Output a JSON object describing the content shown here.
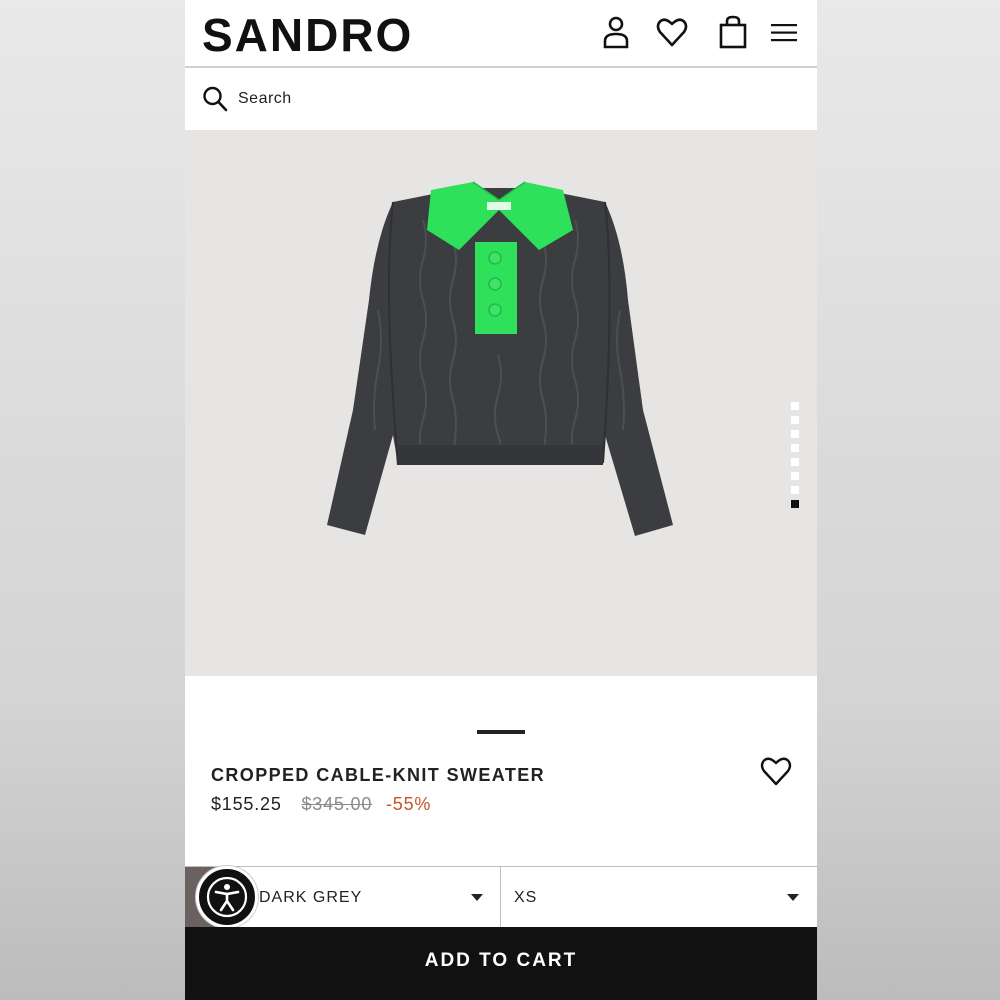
{
  "header": {
    "logo": "SANDRO",
    "icons": [
      "account-icon",
      "wishlist-icon",
      "bag-icon",
      "menu-icon"
    ]
  },
  "search": {
    "placeholder": "Search",
    "icon": "search-icon"
  },
  "gallery": {
    "total_images": 8,
    "active_index": 8,
    "image_alt": "Dark grey cable-knit sweater with bright green collar"
  },
  "product": {
    "name": "CROPPED CABLE-KNIT SWEATER",
    "price": "$155.25",
    "original_price": "$345.00",
    "discount": "-55%"
  },
  "selectors": {
    "color": "DARK GREY",
    "size": "XS"
  },
  "cart": {
    "label": "ADD TO CART"
  },
  "colors": {
    "accent_discount": "#c4542b",
    "swatch": "#6b6161",
    "collar_green": "#2ee05a",
    "sweater_grey": "#3b3d40"
  }
}
